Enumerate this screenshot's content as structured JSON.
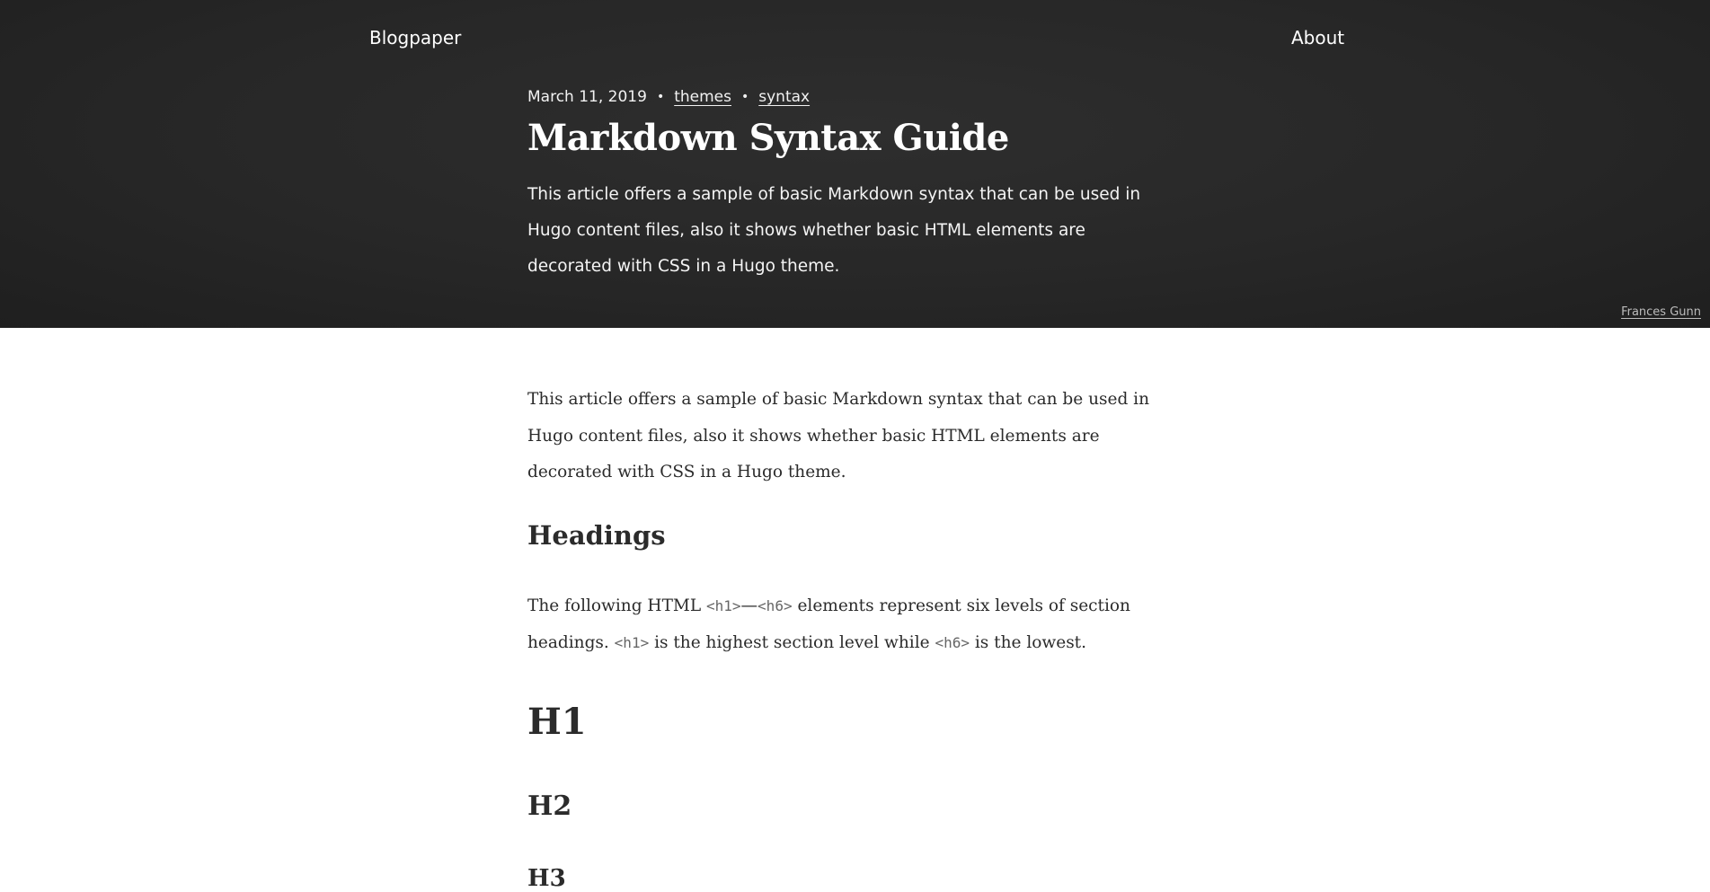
{
  "header": {
    "site_title": "Blogpaper",
    "nav_about": "About",
    "photo_credit": "Frances Gunn"
  },
  "post": {
    "date": "March 11, 2019",
    "separator": "•",
    "tags": [
      "themes",
      "syntax"
    ],
    "title": "Markdown Syntax Guide",
    "summary": "This article offers a sample of basic Markdown syntax that can be used in Hugo content files, also it shows whether basic HTML elements are decorated with CSS in a Hugo theme."
  },
  "content": {
    "intro": "This article offers a sample of basic Markdown syntax that can be used in Hugo content files, also it shows whether basic HTML elements are decorated with CSS in a Hugo theme.",
    "headings_title": "Headings",
    "para_part1": "The following HTML ",
    "code_h1": "<h1>",
    "dash": "—",
    "code_h6": "<h6>",
    "para_part2": " elements represent six levels of section headings. ",
    "para_part3": " is the highest section level while ",
    "para_part4": " is the lowest.",
    "h1_demo": "H1",
    "h2_demo": "H2",
    "h3_demo": "H3"
  },
  "colors": {
    "hero_background": "#272727",
    "hero_text": "#ffffff",
    "body_text": "#2b2b2b"
  }
}
